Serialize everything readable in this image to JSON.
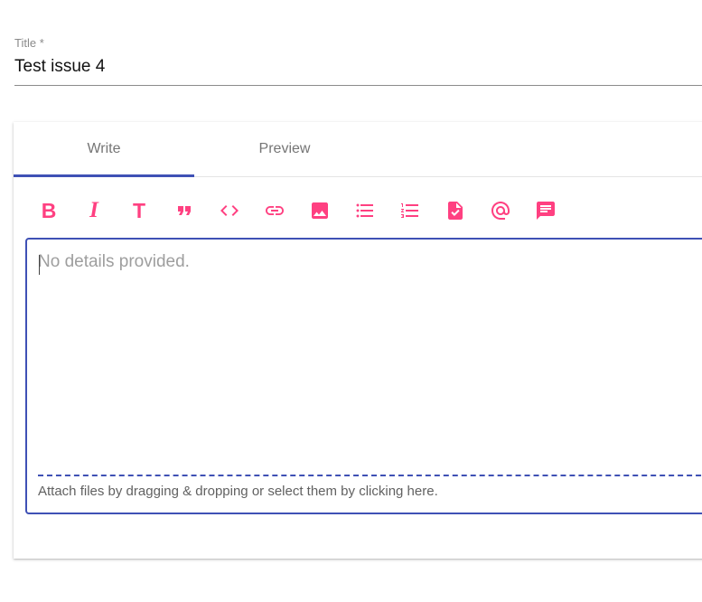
{
  "title_field": {
    "label": "Title *",
    "value": "Test issue 4"
  },
  "tabs": [
    {
      "label": "Write",
      "active": true
    },
    {
      "label": "Preview",
      "active": false
    }
  ],
  "toolbar": {
    "accent_color": "#ff4081",
    "tools": [
      {
        "name": "bold",
        "glyph": "B"
      },
      {
        "name": "italic",
        "glyph": "I"
      },
      {
        "name": "header",
        "glyph": "T"
      },
      {
        "name": "quote",
        "icon": "format-quote-icon"
      },
      {
        "name": "code",
        "icon": "code-icon"
      },
      {
        "name": "link",
        "icon": "link-icon"
      },
      {
        "name": "image",
        "icon": "image-icon"
      },
      {
        "name": "unordered-list",
        "icon": "bulleted-list-icon"
      },
      {
        "name": "ordered-list",
        "icon": "numbered-list-icon"
      },
      {
        "name": "task-list",
        "icon": "task-file-icon"
      },
      {
        "name": "mention",
        "icon": "at-sign-icon"
      },
      {
        "name": "saved-reply",
        "icon": "comment-icon"
      }
    ]
  },
  "editor": {
    "placeholder": "No details provided.",
    "value": "",
    "border_color": "#3f51b5"
  },
  "dropzone": {
    "text": "Attach files by dragging & dropping or select them by clicking here."
  }
}
